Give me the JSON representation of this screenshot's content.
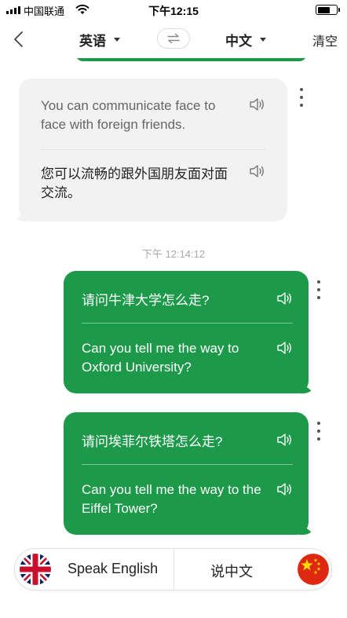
{
  "status_bar": {
    "carrier": "中国联通",
    "time": "下午12:15"
  },
  "header": {
    "source_lang": "英语",
    "target_lang": "中文",
    "clear_label": "清空"
  },
  "messages": [
    {
      "direction": "received",
      "source_text": "You can communicate face to face with foreign friends.",
      "translation": "您可以流畅的跟外国朋友面对面交流。"
    },
    {
      "direction": "sent",
      "source_text": "请问牛津大学怎么走?",
      "translation": "Can you tell me the way to Oxford University?"
    },
    {
      "direction": "sent",
      "source_text": "请问埃菲尔铁塔怎么走?",
      "translation": "Can you tell me the way to the Eiffel Tower?"
    }
  ],
  "timestamp": "下午 12:14:12",
  "bottom_bar": {
    "speak_english_label": "Speak English",
    "speak_chinese_label": "说中文"
  },
  "colors": {
    "accent_green": "#1c9a4a",
    "received_bubble": "#f2f2f2",
    "uk_blue": "#012169",
    "uk_red": "#C8102E",
    "cn_red": "#DE2910",
    "cn_yellow": "#FFDE00"
  },
  "icons": [
    "back-arrow-icon",
    "caret-down-icon",
    "swap-icon",
    "speaker-icon",
    "more-vertical-icon",
    "uk-flag-icon",
    "china-flag-icon",
    "wifi-icon",
    "signal-icon",
    "battery-icon"
  ]
}
